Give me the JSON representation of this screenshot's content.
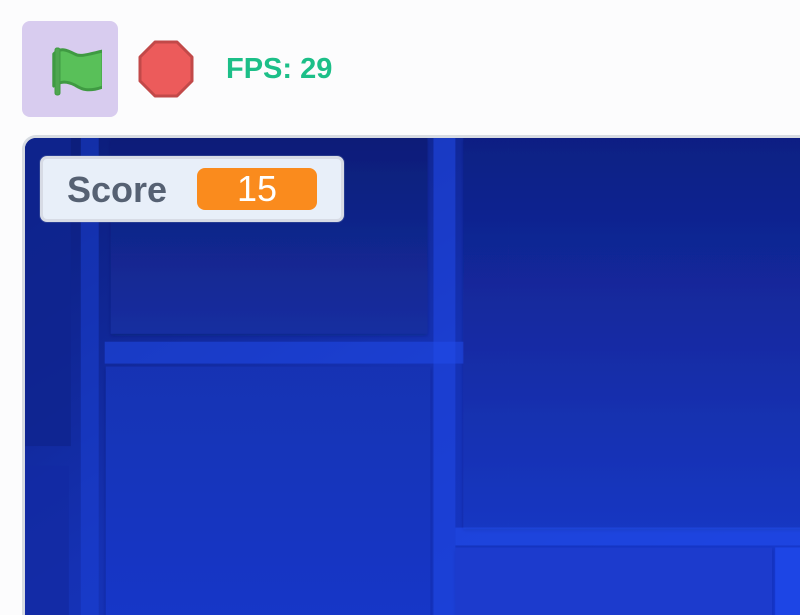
{
  "toolbar": {
    "green_flag_icon": "green-flag-icon",
    "stop_icon": "stop-icon",
    "fps_text": "FPS: 29"
  },
  "stage": {
    "background": "blue-maze-pattern",
    "monitor": {
      "label": "Score",
      "value": "15"
    }
  },
  "colors": {
    "flag_button_bg": "#d8ccef",
    "flag_green": "#59c059",
    "stop_red": "#ec5b5b",
    "fps_green": "#1cbf88",
    "stage_blue": "#1734b8",
    "monitor_orange": "#fa8b1d",
    "monitor_bg": "#e8eff9"
  }
}
